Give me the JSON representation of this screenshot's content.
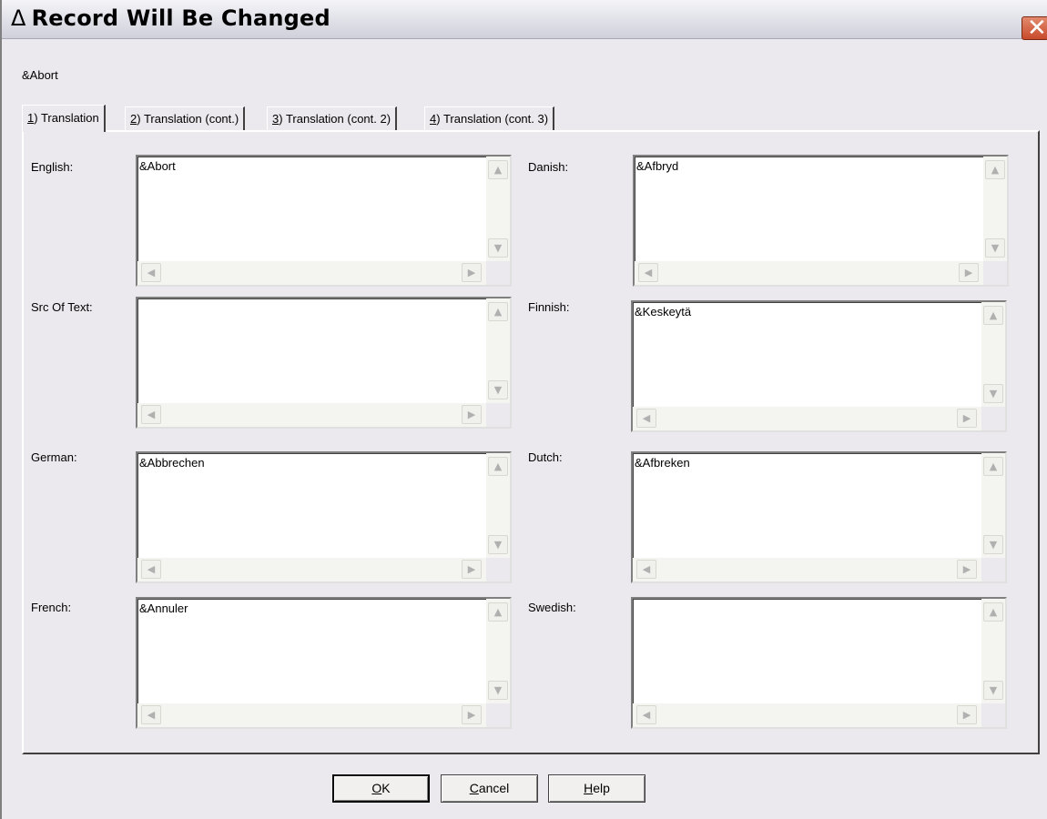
{
  "window": {
    "title": "Record Will Be Changed",
    "title_symbol": "Δ",
    "close_glyph": "✕"
  },
  "record_label": "&Abort",
  "tabs": [
    {
      "accel": "1",
      "label": ") Translation"
    },
    {
      "accel": "2",
      "label": ") Translation (cont.)"
    },
    {
      "accel": "3",
      "label": ") Translation (cont. 2)"
    },
    {
      "accel": "4",
      "label": ") Translation (cont. 3)"
    }
  ],
  "fields": {
    "english": {
      "label": "English:",
      "value": "&Abort"
    },
    "src_of_text": {
      "label": "Src Of Text:",
      "value": ""
    },
    "german": {
      "label": "German:",
      "value": "&Abbrechen"
    },
    "french": {
      "label": "French:",
      "value": "&Annuler"
    },
    "danish": {
      "label": "Danish:",
      "value": "&Afbryd"
    },
    "finnish": {
      "label": "Finnish:",
      "value": "&Keskeytä"
    },
    "dutch": {
      "label": "Dutch:",
      "value": "&Afbreken"
    },
    "swedish": {
      "label": "Swedish:",
      "value": ""
    }
  },
  "buttons": {
    "ok": {
      "accel": "O",
      "rest": "K"
    },
    "cancel": {
      "accel": "C",
      "rest": "ancel"
    },
    "help": {
      "accel": "H",
      "rest": "elp"
    }
  },
  "scroll_glyphs": {
    "up": "▲",
    "down": "▼",
    "left": "◀",
    "right": "▶"
  },
  "colors": {
    "title_bar": "#dcdce6",
    "close_button": "#d4603f",
    "dialog_bg": "#ebe9ed"
  }
}
